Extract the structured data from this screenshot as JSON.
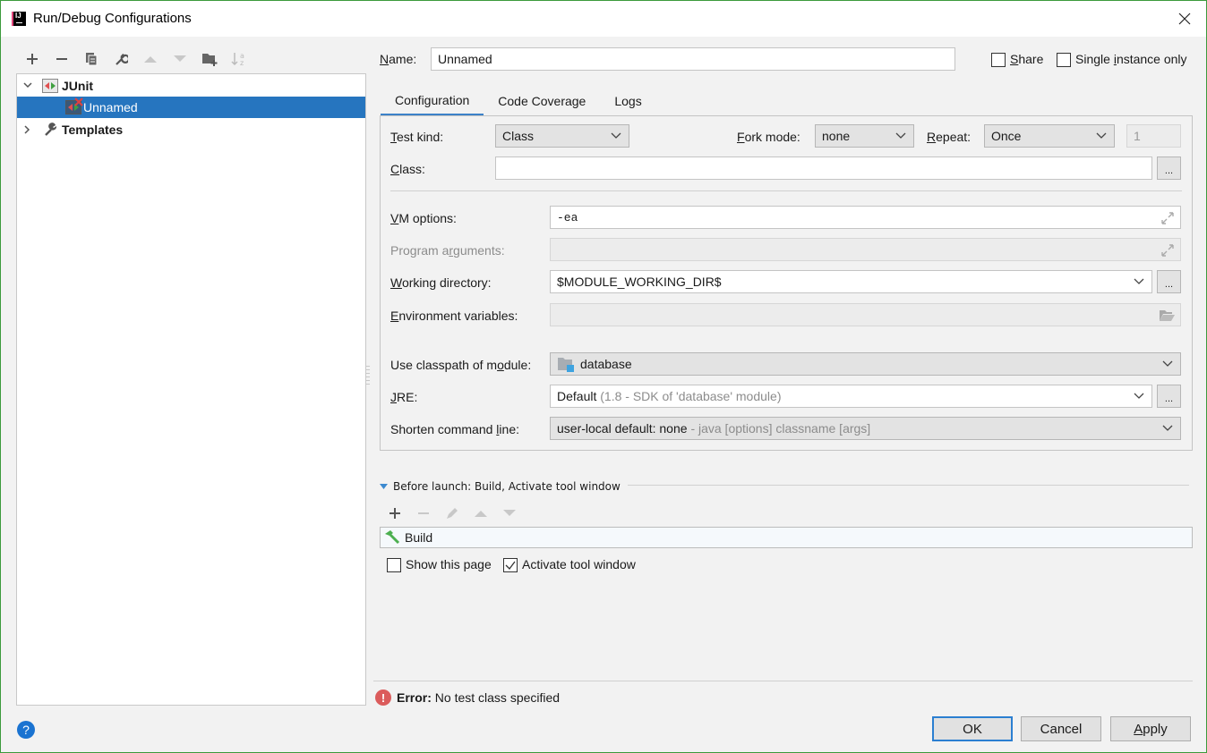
{
  "window": {
    "title": "Run/Debug Configurations",
    "app_icon_label": "IJ"
  },
  "left_toolbar": {
    "icons": [
      "add-icon",
      "remove-icon",
      "copy-icon",
      "wrench-icon",
      "move-up-icon",
      "move-down-icon",
      "new-folder-icon",
      "sort-alpha-icon"
    ]
  },
  "tree": {
    "items": [
      {
        "label": "JUnit",
        "level": 0,
        "expanded": true,
        "bold": true,
        "icon": "junit-icon"
      },
      {
        "label": "Unnamed",
        "level": 1,
        "selected": true,
        "icon": "junit-config-error-icon"
      },
      {
        "label": "Templates",
        "level": 0,
        "expanded": false,
        "bold": true,
        "icon": "wrench-icon"
      }
    ]
  },
  "header": {
    "name_label": "Name:",
    "name_mnemonic": "N",
    "name_value": "Unnamed",
    "share_label": "Share",
    "share_checked": false,
    "single_instance_label": "Single instance only",
    "single_instance_checked": false
  },
  "tabs": [
    {
      "label": "Configuration",
      "active": true
    },
    {
      "label": "Code Coverage",
      "active": false
    },
    {
      "label": "Logs",
      "active": false
    }
  ],
  "config": {
    "test_kind_label": "Test kind:",
    "test_kind_value": "Class",
    "fork_mode_label": "Fork mode:",
    "fork_mode_value": "none",
    "repeat_label": "Repeat:",
    "repeat_value": "Once",
    "repeat_count": "1",
    "class_label": "Class:",
    "class_value": "",
    "class_browse": "...",
    "vm_options_label": "VM options:",
    "vm_options_value": "-ea",
    "program_args_label": "Program arguments:",
    "program_args_value": "",
    "working_dir_label": "Working directory:",
    "working_dir_value": "$MODULE_WORKING_DIR$",
    "working_dir_browse": "...",
    "env_vars_label": "Environment variables:",
    "env_vars_value": "",
    "classpath_label": "Use classpath of module:",
    "classpath_value": "database",
    "jre_label": "JRE:",
    "jre_value": "Default",
    "jre_note": "(1.8 - SDK of 'database' module)",
    "jre_browse": "...",
    "shorten_label": "Shorten command line:",
    "shorten_value": "user-local default: none",
    "shorten_note": "- java [options] classname [args]"
  },
  "before_launch": {
    "title": "Before launch: Build, Activate tool window",
    "tasks": [
      {
        "label": "Build",
        "icon": "hammer-icon"
      }
    ],
    "show_this_page_label": "Show this page",
    "show_this_page_checked": false,
    "activate_tool_window_label": "Activate tool window",
    "activate_tool_window_checked": true
  },
  "status": {
    "error_prefix": "Error:",
    "error_message": "No test class specified"
  },
  "buttons": {
    "ok": "OK",
    "cancel": "Cancel",
    "apply": "Apply",
    "help": "?"
  },
  "colors": {
    "selection": "#2675bf",
    "tab_underline": "#3c82c8",
    "error": "#db5c5c",
    "help": "#1a73d1",
    "build_icon": "#4caf50"
  }
}
